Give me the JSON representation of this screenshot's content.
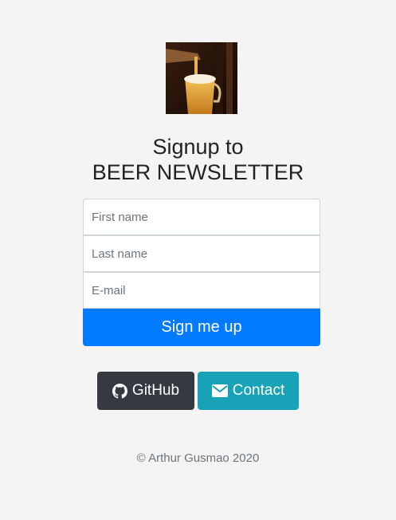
{
  "logo": {
    "icon": "beer-pour-image"
  },
  "title": {
    "line1": "Signup to",
    "line2": "BEER NEWSLETTER"
  },
  "form": {
    "first_name_placeholder": "First name",
    "last_name_placeholder": "Last name",
    "email_placeholder": "E-mail",
    "submit_label": "Sign me up"
  },
  "links": {
    "github_label": "GitHub",
    "github_icon": "github-icon",
    "contact_label": "Contact",
    "contact_icon": "envelope-icon"
  },
  "footer": {
    "copyright": "© Arthur Gusmao 2020"
  },
  "colors": {
    "background": "#f4f4f4",
    "primary": "#007bff",
    "dark": "#343a40",
    "info": "#17a2b8"
  }
}
